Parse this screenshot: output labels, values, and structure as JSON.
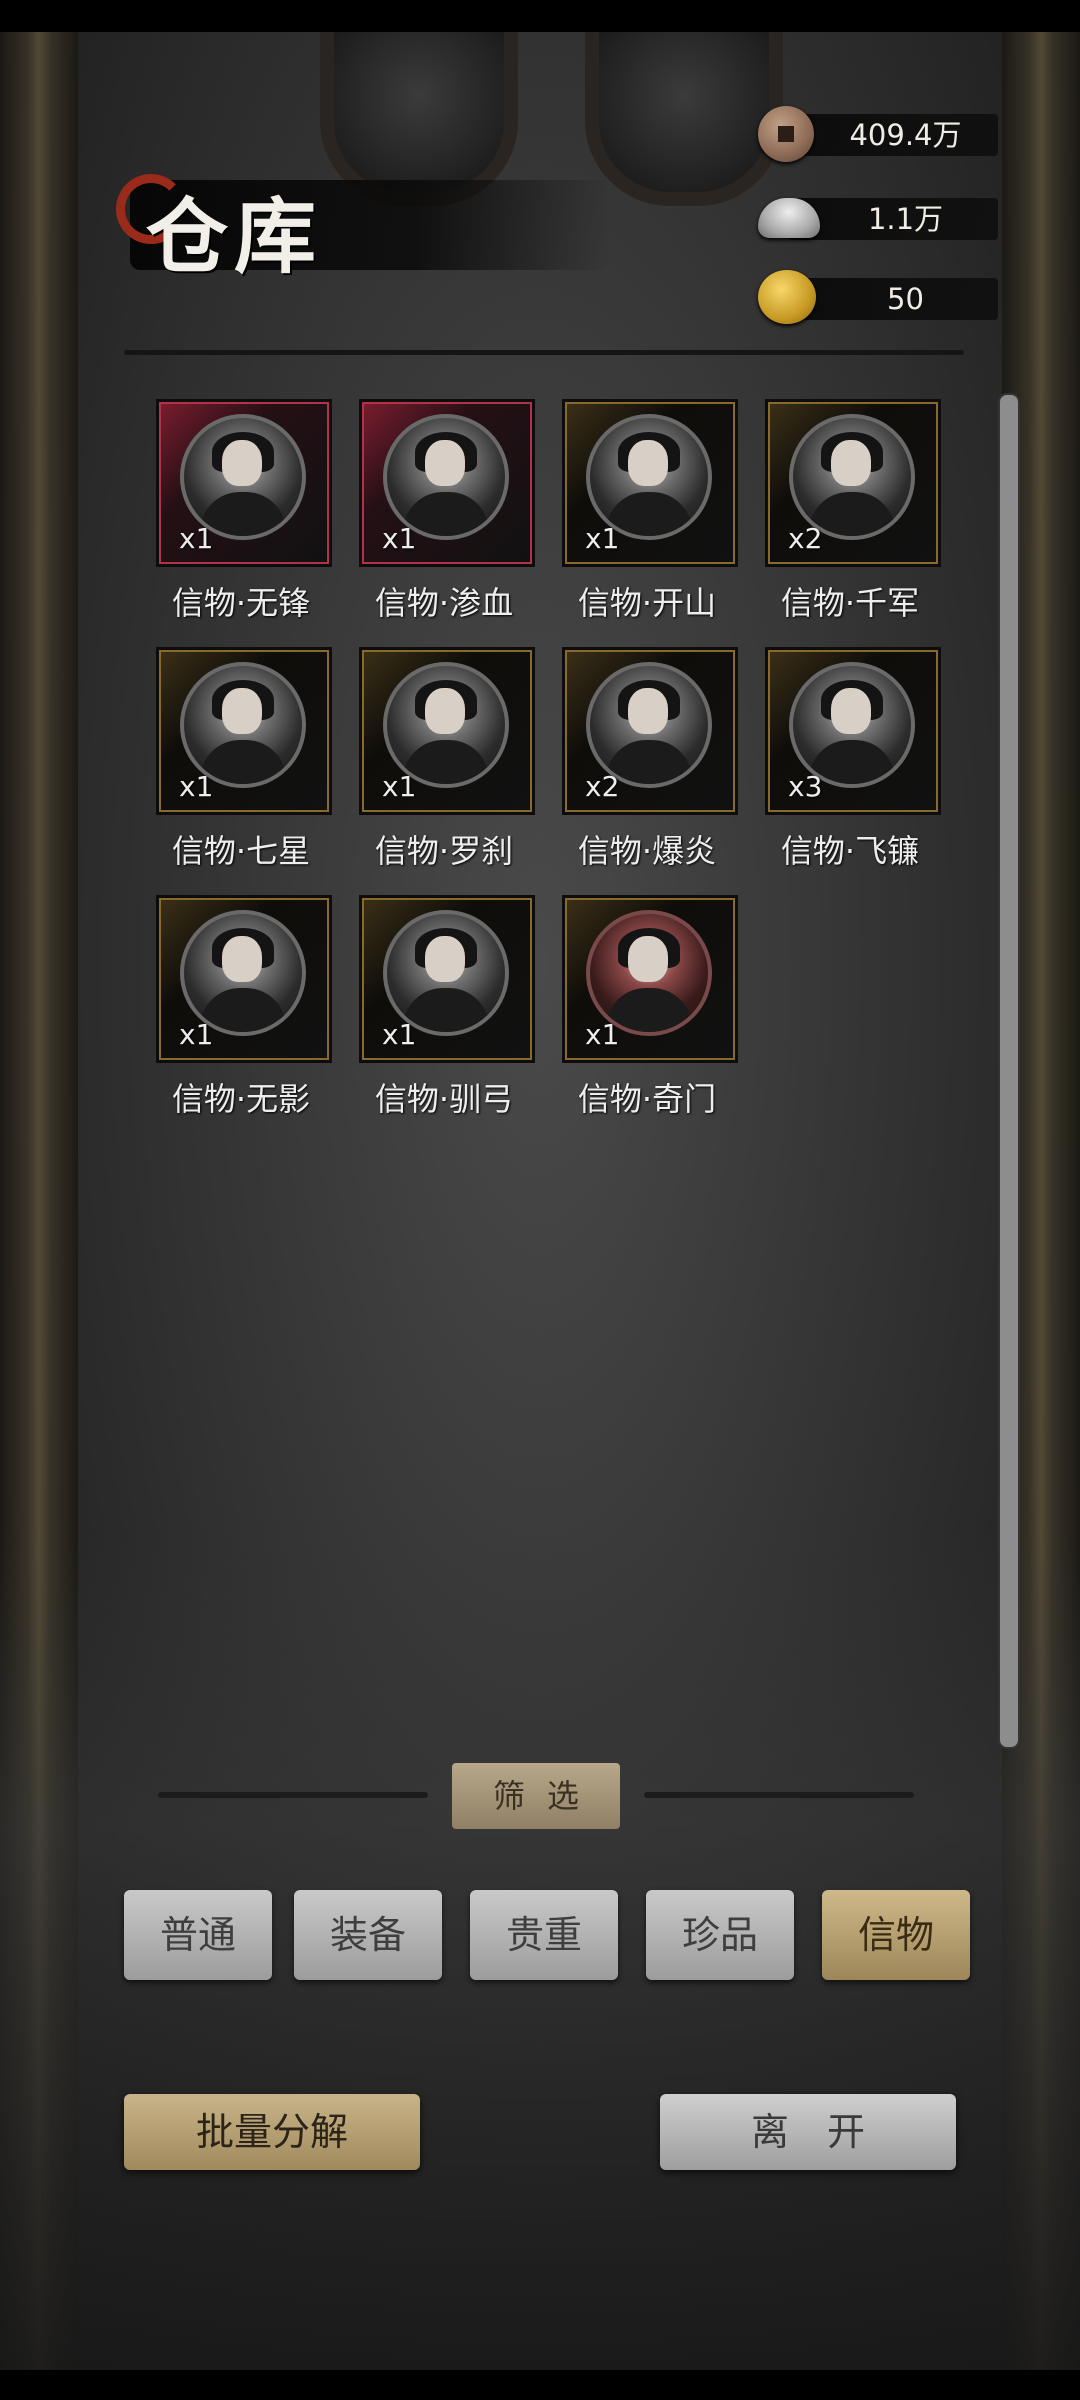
{
  "header": {
    "title": "仓库",
    "currencies": [
      {
        "icon": "copper-coin-icon",
        "value": "409.4万"
      },
      {
        "icon": "silver-ingot-icon",
        "value": "1.1万"
      },
      {
        "icon": "gold-coin-icon",
        "value": "50"
      }
    ]
  },
  "items": [
    {
      "label": "信物·无锋",
      "qty": "x1",
      "frame": "red"
    },
    {
      "label": "信物·渗血",
      "qty": "x1",
      "frame": "red"
    },
    {
      "label": "信物·开山",
      "qty": "x1",
      "frame": "gold"
    },
    {
      "label": "信物·千军",
      "qty": "x2",
      "frame": "gold"
    },
    {
      "label": "信物·七星",
      "qty": "x1",
      "frame": "gold"
    },
    {
      "label": "信物·罗刹",
      "qty": "x1",
      "frame": "gold"
    },
    {
      "label": "信物·爆炎",
      "qty": "x2",
      "frame": "gold"
    },
    {
      "label": "信物·飞镰",
      "qty": "x3",
      "frame": "gold"
    },
    {
      "label": "信物·无影",
      "qty": "x1",
      "frame": "gold"
    },
    {
      "label": "信物·驯弓",
      "qty": "x1",
      "frame": "gold"
    },
    {
      "label": "信物·奇门",
      "qty": "x1",
      "frame": "gold"
    }
  ],
  "filter": {
    "title": "筛选",
    "tabs": [
      "普通",
      "装备",
      "贵重",
      "珍品",
      "信物"
    ],
    "selected": "信物"
  },
  "actions": {
    "batch_decompose": "批量分解",
    "leave": "离开"
  },
  "colors": {
    "accent_gold": "#c9b489",
    "frame_red": "#b0334a",
    "frame_gold": "#8a6a2c"
  }
}
